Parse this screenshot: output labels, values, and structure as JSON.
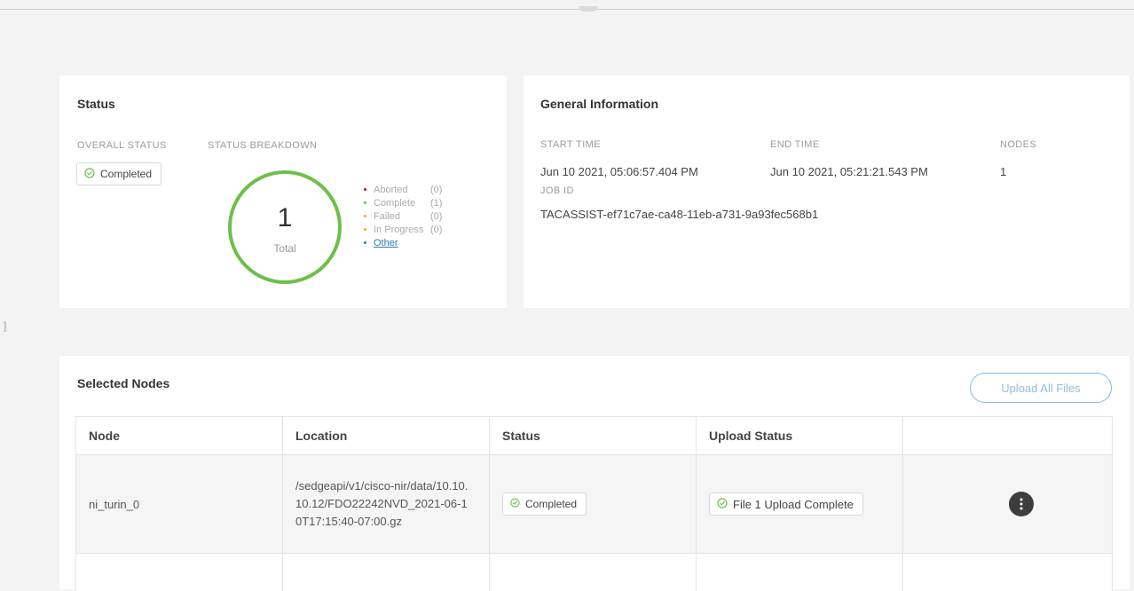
{
  "status_card": {
    "title": "Status",
    "overall_label": "OVERALL STATUS",
    "overall_value": "Completed",
    "breakdown_label": "STATUS BREAKDOWN",
    "total_count": "1",
    "total_label": "Total",
    "ring_color": "#6cc04a",
    "legend": [
      {
        "name": "Aborted",
        "count": "(0)",
        "color": "#d0021b"
      },
      {
        "name": "Complete",
        "count": "(1)",
        "color": "#6cc04a"
      },
      {
        "name": "Failed",
        "count": "(0)",
        "color": "#f5a623"
      },
      {
        "name": "In Progress",
        "count": "(0)",
        "color": "#f5a623"
      }
    ],
    "other_label": "Other",
    "other_color": "#2a7ab0"
  },
  "info_card": {
    "title": "General Information",
    "start_time_label": "START TIME",
    "start_time": "Jun 10 2021, 05:06:57.404 PM",
    "end_time_label": "END TIME",
    "end_time": "Jun 10 2021, 05:21:21.543 PM",
    "nodes_label": "NODES",
    "nodes": "1",
    "job_id_label": "JOB ID",
    "job_id": "TACASSIST-ef71c7ae-ca48-11eb-a731-9a93fec568b1"
  },
  "nodes_card": {
    "title": "Selected Nodes",
    "upload_all_label": "Upload All Files",
    "columns": [
      "Node",
      "Location",
      "Status",
      "Upload Status",
      ""
    ],
    "rows": [
      {
        "node": "ni_turin_0",
        "location": "/sedgeapi/v1/cisco-nir/data/10.10.10.12/FDO22242NVD_2021-06-10T17:15:40-07:00.gz",
        "status": "Completed",
        "upload_status": "File 1 Upload Complete"
      }
    ]
  }
}
